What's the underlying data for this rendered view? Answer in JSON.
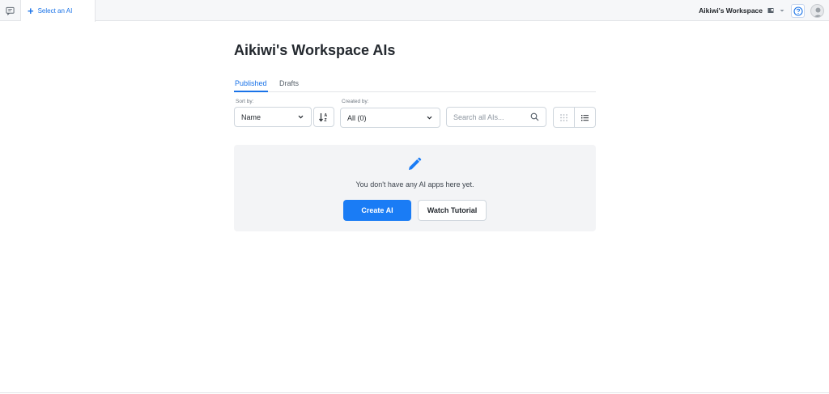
{
  "header": {
    "tab_label": "Select an AI",
    "workspace_name": "Aikiwi's Workspace",
    "icons": [
      "chat-icon",
      "plus-icon",
      "folder-icon",
      "chevron-down-icon",
      "help-icon",
      "avatar-icon"
    ]
  },
  "page": {
    "title": "Aikiwi's Workspace AIs",
    "tabs": [
      {
        "label": "Published",
        "active": true
      },
      {
        "label": "Drafts",
        "active": false
      }
    ]
  },
  "filters": {
    "sort_by_label": "Sort by:",
    "sort_by_value": "Name",
    "created_by_label": "Created by:",
    "created_by_value": "All (0)",
    "search_placeholder": "Search all AIs..."
  },
  "empty_state": {
    "message": "You don't have any AI apps here yet.",
    "create_label": "Create AI",
    "tutorial_label": "Watch Tutorial"
  },
  "colors": {
    "accent": "#1a7cf5",
    "empty_bg": "#f3f4f6"
  }
}
